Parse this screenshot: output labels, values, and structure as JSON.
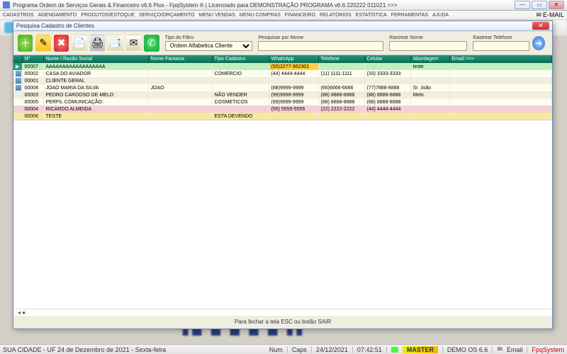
{
  "outer_window": {
    "title": "Programa Ordem de Serviços Gerais & Financeiro v6.6 Plus - FpqSystem ® | Licenciado para  DEMONSTRAÇÃO PROGRAMA v6.6 220222 011021 >>>"
  },
  "menubar": {
    "items": [
      "CADASTROS",
      "AGENDAMENTO",
      "PRODUTOS/ESTOQUE",
      "SERVIÇO/ORÇAMENTO",
      "MENU VENDAS",
      "MENU COMPRAS",
      "FINANCEIRO",
      "RELATÓRIOS",
      "ESTATÍSTICA",
      "FERRAMENTAS",
      "AJUDA"
    ],
    "email_label": "E-MAIL"
  },
  "dialog": {
    "title": "Pesquisa Cadastro de Clientes",
    "filters": {
      "tipo_label": "Tipo do Filtro",
      "tipo_value": "Ordem Alfabetica Cliente",
      "pesq_label": "Pesquisar por Nome",
      "pesq_value": "",
      "rastrear_nome_label": "Rastrear Nome",
      "rastrear_nome_value": "",
      "rastrear_tel_label": "Rastrear Telefone",
      "rastrear_tel_value": ""
    },
    "columns": [
      "Nº",
      "Nome / Razão Social",
      "Nome Fantasia",
      "Tipo Cadastro",
      "WhatsApp",
      "Telefone",
      "Celular",
      "Abordagem",
      "Email >>>"
    ],
    "rows": [
      {
        "cls": "r0",
        "num": "00007",
        "nome": "AAAAAAAAAAAAAAAAAA",
        "fant": "",
        "tipo": "",
        "wa": "(55)2277-962301",
        "tel": "",
        "cel": "",
        "abord": "teste",
        "email": ""
      },
      {
        "cls": "light",
        "num": "00002",
        "nome": "CASA DO AVIADOR",
        "fant": "",
        "tipo": "COMERCIO",
        "wa": "(44) 4444-4444",
        "tel": "(11) 1111-1111",
        "cel": "(33) 3333-3333",
        "abord": "",
        "email": ""
      },
      {
        "cls": "alt",
        "num": "00001",
        "nome": "CLIENTE GERAL",
        "fant": "",
        "tipo": "",
        "wa": "",
        "tel": "",
        "cel": "",
        "abord": "",
        "email": ""
      },
      {
        "cls": "light",
        "num": "00008",
        "nome": "JOAO MARIA DA SILVA",
        "fant": "JOAO",
        "tipo": "",
        "wa": "(88)9999-9999",
        "tel": "(66)6666-6666",
        "cel": "(77)7888-8888",
        "abord": "Sr. João",
        "email": ""
      },
      {
        "cls": "alt",
        "num": "00003",
        "nome": "PEDRO CARDOSO DE MELO",
        "fant": "",
        "tipo": "NÃO VENDER",
        "wa": "(99)9999-9999",
        "tel": "(88) 8888-8888",
        "cel": "(88) 8888-8888",
        "abord": "Melo",
        "email": ""
      },
      {
        "cls": "light",
        "num": "00005",
        "nome": "PERFIL COMUNICAÇÃO",
        "fant": "",
        "tipo": "COSMETICOS",
        "wa": "(99)9999-9999",
        "tel": "(88) 8888-8888",
        "cel": "(88) 8888-8888",
        "abord": "",
        "email": ""
      },
      {
        "cls": "pink",
        "num": "00004",
        "nome": "RICARDO ALMEIDA",
        "fant": "",
        "tipo": "",
        "wa": "(55) 5555-5555",
        "tel": "(22) 2222-2222",
        "cel": "(44) 4444-4444",
        "abord": "",
        "email": ""
      },
      {
        "cls": "yellow",
        "num": "00006",
        "nome": "TESTE",
        "fant": "",
        "tipo": "ESTA DEVENDO",
        "wa": "",
        "tel": "",
        "cel": "",
        "abord": "",
        "email": ""
      }
    ],
    "hint": "Para fechar a tela ESC ou botão SAIR"
  },
  "statusbar": {
    "city": "SUA CIDADE - UF 24 de Dezembro de 2021 - Sexta-feira",
    "num": "Num",
    "caps": "Caps",
    "date": "24/12/2021",
    "time": "07:42:51",
    "master": "MASTER",
    "demo": "DEMO OS 6.6",
    "email": "Email",
    "brand": "FpqSystem"
  }
}
